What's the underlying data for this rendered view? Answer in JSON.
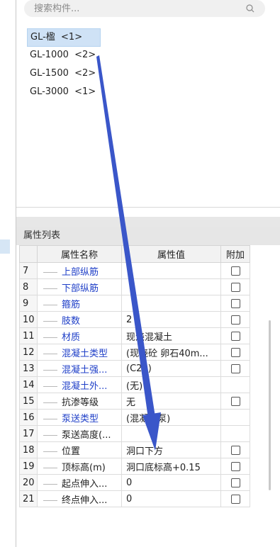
{
  "search": {
    "placeholder": "搜索构件..."
  },
  "tree": {
    "items": [
      {
        "label": "GL-楹  <1>",
        "selected": true
      },
      {
        "label": "GL-1000  <2>",
        "selected": false
      },
      {
        "label": "GL-1500  <2>",
        "selected": false
      },
      {
        "label": "GL-3000  <1>",
        "selected": false
      }
    ]
  },
  "props": {
    "title": "属性列表",
    "columns": {
      "name": "属性名称",
      "value": "属性值",
      "extra": "附加"
    },
    "rows": [
      {
        "num": "7",
        "name": "上部纵筋",
        "value": "",
        "blue": true,
        "checkbox": true
      },
      {
        "num": "8",
        "name": "下部纵筋",
        "value": "",
        "blue": true,
        "checkbox": true
      },
      {
        "num": "9",
        "name": "箍筋",
        "value": "",
        "blue": true,
        "checkbox": true
      },
      {
        "num": "10",
        "name": "肢数",
        "value": "2",
        "blue": true,
        "checkbox": true
      },
      {
        "num": "11",
        "name": "材质",
        "value": "现浇混凝土",
        "blue": true,
        "checkbox": true
      },
      {
        "num": "12",
        "name": "混凝土类型",
        "value": "(现浇砼 卵石40m...",
        "blue": true,
        "checkbox": true
      },
      {
        "num": "13",
        "name": "混凝土强...",
        "value": "(C20)",
        "blue": true,
        "checkbox": true
      },
      {
        "num": "14",
        "name": "混凝土外...",
        "value": "(无)",
        "blue": true,
        "checkbox": false
      },
      {
        "num": "15",
        "name": "抗渗等级",
        "value": "无",
        "blue": false,
        "checkbox": true
      },
      {
        "num": "16",
        "name": "泵送类型",
        "value": "(混凝土泵)",
        "blue": true,
        "checkbox": false
      },
      {
        "num": "17",
        "name": "泵送高度(...",
        "value": "",
        "blue": false,
        "checkbox": false
      },
      {
        "num": "18",
        "name": "位置",
        "value": "洞口下方",
        "blue": false,
        "checkbox": true
      },
      {
        "num": "19",
        "name": "顶标高(m)",
        "value": "洞口底标高+0.15",
        "blue": false,
        "checkbox": true
      },
      {
        "num": "20",
        "name": "起点伸入...",
        "value": "0",
        "blue": false,
        "checkbox": true
      },
      {
        "num": "21",
        "name": "终点伸入...",
        "value": "0",
        "blue": false,
        "checkbox": true
      }
    ]
  },
  "colors": {
    "link_blue": "#2040c8",
    "annotation_arrow": "#3a56c9",
    "selection": "#cfe2f6"
  },
  "icons": {
    "search": "search-icon",
    "checkbox": "checkbox-icon"
  }
}
